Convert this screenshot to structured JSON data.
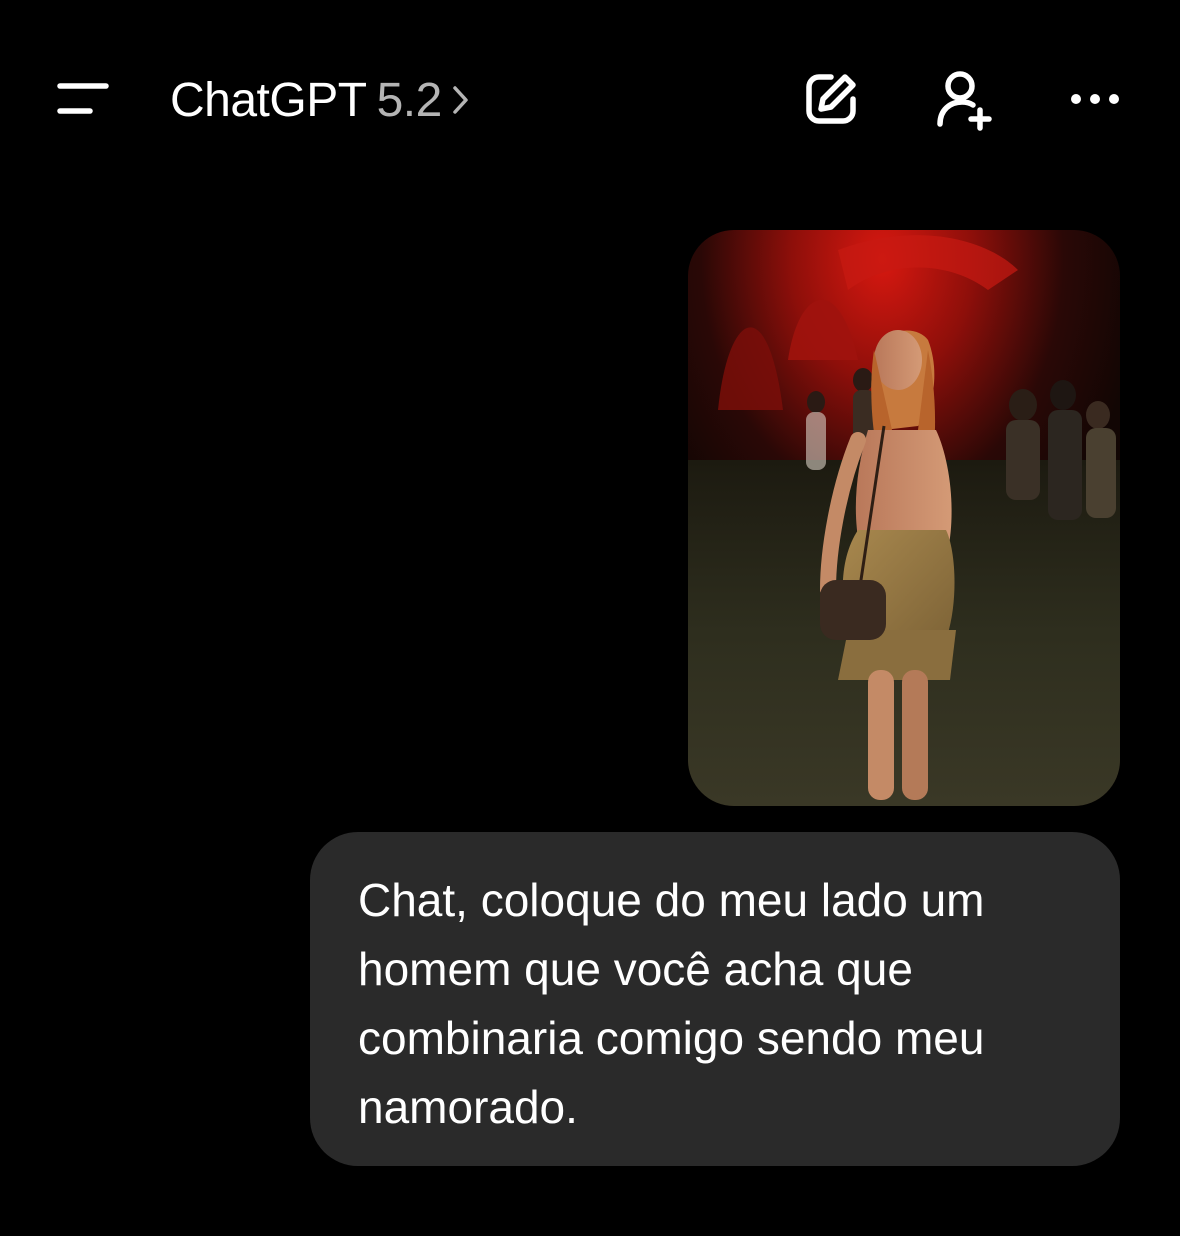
{
  "header": {
    "app_name": "ChatGPT",
    "model_version": "5.2",
    "menu_icon": "sidebar-menu-icon",
    "chevron_icon": "chevron-right-icon",
    "new_chat_icon": "edit-icon",
    "add_people_icon": "add-user-icon",
    "more_icon": "more-horizontal-icon"
  },
  "conversation": {
    "user_image": {
      "kind": "photo",
      "description_icon": "photo-attachment"
    },
    "user_message": "Chat, coloque do meu lado um\nhomem que você acha que\ncombinaria comigo sendo meu\nnamorado."
  },
  "colors": {
    "background": "#000000",
    "bubble": "#2a2a2a",
    "text": "#ffffff",
    "muted": "#b4b4b4"
  }
}
